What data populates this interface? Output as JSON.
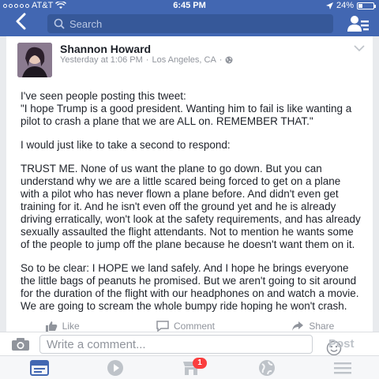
{
  "status_bar": {
    "carrier": "AT&T",
    "time": "6:45 PM",
    "battery": "24%"
  },
  "nav": {
    "search_placeholder": "Search"
  },
  "post": {
    "author": "Shannon Howard",
    "time": "Yesterday at 1:06 PM",
    "location": "Los Angeles, CA",
    "paragraphs": [
      "I've seen people posting this tweet:\n\"I hope Trump is a good president. Wanting him to fail is like wanting a pilot to crash a plane that we are ALL on. REMEMBER THAT.\"",
      "I would just like to take a second to respond:",
      "TRUST ME.  None of us want the plane to go down. But you can understand why we are a little scared being forced to get on a plane with a pilot who has never flown a plane before. And didn't even get training for it. And he isn't even off the ground yet and he is already driving erratically, won't look at the safety requirements, and has already sexually assaulted the flight attendants. Not to mention he wants some of the people to jump off the plane because he doesn't want them on it.",
      "So to be clear: I HOPE we land safely. And I hope he brings everyone the little bags of peanuts he promised.  But we aren't going to sit around for the duration of the flight with our headphones on and watch a movie. We are going to scream the whole bumpy ride hoping he won't crash."
    ],
    "actions": {
      "like": "Like",
      "comment": "Comment",
      "share": "Share"
    }
  },
  "comment_bar": {
    "placeholder": "Write a comment...",
    "post_label": "Post"
  },
  "tab_bar": {
    "notifications_badge": "1"
  },
  "colors": {
    "brand": "#4267b2",
    "badge": "#fa3e3e"
  }
}
